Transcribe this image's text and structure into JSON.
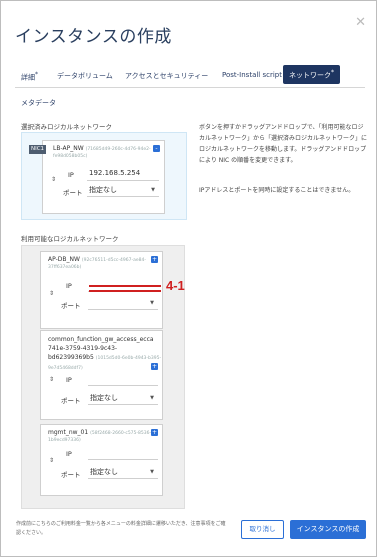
{
  "dialog": {
    "title": "インスタンスの作成",
    "close_icon": "close-icon"
  },
  "tabs": [
    {
      "label": "詳細",
      "mark": "*"
    },
    {
      "label": "データボリューム",
      "mark": ""
    },
    {
      "label": "アクセスとセキュリティー",
      "mark": ""
    },
    {
      "label": "Post-Install script",
      "mark": ""
    },
    {
      "label": "ネットワーク",
      "mark": "*",
      "active": true
    },
    {
      "label": "メタデータ",
      "mark": ""
    }
  ],
  "selected_section": {
    "label": "選択済みロジカルネットワーク",
    "card": {
      "badge": "NIC1",
      "name": "LB-AP_NW",
      "uuid": "(71685d49-260c-4d76-94e2-fe98d058b05c)",
      "action": "-",
      "ip_label": "IP",
      "ip_value": "192.168.5.254",
      "port_label": "ポート",
      "port_value": "指定なし"
    }
  },
  "available_section": {
    "label": "利用可能なロジカルネットワーク",
    "cards": [
      {
        "name": "AP-DB_NW",
        "uuid": "(92c76511-d5cc-4967-ae84-37ff637ea06b)",
        "action": "+",
        "ip_label": "IP",
        "ip_value": "",
        "port_label": "ポート",
        "port_value": ""
      },
      {
        "name_line1": "common_function_gw_access_ecca",
        "name_line2": "741e-3759-4319-9c43-",
        "name_line3": "bd62399369b5",
        "uuid": "(1015d5d0-6e0b-4943-b395-9e7d5468ddf7)",
        "action": "+",
        "ip_label": "IP",
        "ip_value": "",
        "port_label": "ポート",
        "port_value": "指定なし"
      },
      {
        "name": "mgmt_nw_01",
        "uuid": "(58f2468-2660-c575-8536-1b9ecd97336)",
        "action": "+",
        "ip_label": "IP",
        "ip_value": "",
        "port_label": "ポート",
        "port_value": "指定なし"
      }
    ]
  },
  "description": {
    "p1": "ボタンを押すかドラッグアンドドロップで、「利用可能なロジカルネットワーク」から「選択済みロジカルネットワーク」にロジカルネットワークを移動します。ドラッグアンドドロップにより NIC の順番を変更できます。",
    "p2": "IPアドレスとポートを同時に設定することはできません。"
  },
  "annotation": {
    "label": "4-1",
    "color": "#d02020"
  },
  "footer": {
    "note": "作成前にこちらのご利用料金一覧から各メニューの料金詳細に遷移いただき、注意事項をご確認ください。",
    "cancel_label": "取り消し",
    "create_label": "インスタンスの作成"
  },
  "colors": {
    "accent": "#2b6fd6",
    "tab_active": "#1e3561",
    "title": "#2a3f5f"
  }
}
